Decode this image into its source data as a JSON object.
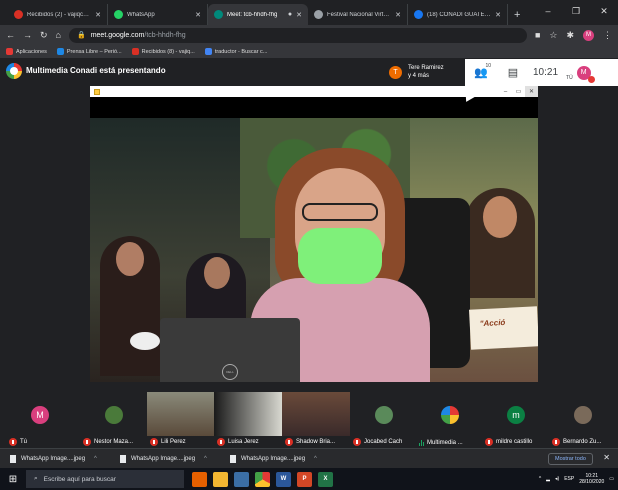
{
  "browser": {
    "tabs": [
      {
        "label": "Recibidos (2) - vajiqconad",
        "color": "#d93025"
      },
      {
        "label": "WhatsApp",
        "color": "#25d366"
      },
      {
        "label": "Meet: tcb-hhdh-fhg",
        "color": "#00897b"
      },
      {
        "label": "Festival Nacional Virtual In",
        "color": "#9aa0a6"
      },
      {
        "label": "(18) CONADI GUATEMALA",
        "color": "#1877f2"
      }
    ],
    "new_tab": "+",
    "url_host": "meet.google.com",
    "url_path": "/tcb-hhdh-fhg",
    "profile_letter": "M"
  },
  "bookmarks": [
    {
      "label": "Aplicaciones",
      "color": "#e53935"
    },
    {
      "label": "Prensa Libre – Perió...",
      "color": "#1e88e5"
    },
    {
      "label": "Recibidos (8) - vajiq...",
      "color": "#d93025"
    },
    {
      "label": "traductor - Buscar c...",
      "color": "#4285f4"
    }
  ],
  "meet": {
    "presenting_text": "Multimedia Conadi está presentando",
    "join_avatar": "T",
    "join_name": "Tere Ramirez",
    "join_sub": "y 4 más",
    "participants_count": "10",
    "time": "10:21",
    "you_label": "TÚ",
    "avatar_letter": "M",
    "banner_text": "\"Acció"
  },
  "participants": [
    {
      "name": "Tú",
      "avatar": "M",
      "color": "#d93f7e",
      "muted": true
    },
    {
      "name": "Nestor Maza...",
      "avatar": "",
      "color": "#4a7a3a",
      "muted": true
    },
    {
      "name": "Lili Perez",
      "avatar": "",
      "color": "#6b5d4a",
      "muted": true
    },
    {
      "name": "Luisa Jerez",
      "avatar": "",
      "color": "#3a3a3a",
      "muted": true
    },
    {
      "name": "Shadow Bria...",
      "avatar": "",
      "color": "#4a3a4a",
      "muted": true
    },
    {
      "name": "Jocabed Cach",
      "avatar": "",
      "color": "#5a8a5a",
      "muted": true
    },
    {
      "name": "Multimedia ...",
      "avatar": "",
      "color": "#5a6aa0",
      "muted": false
    },
    {
      "name": "mildre castillo",
      "avatar": "m",
      "color": "#0b8043",
      "muted": true
    },
    {
      "name": "Bernardo Zu...",
      "avatar": "",
      "color": "#7a6a5a",
      "muted": true
    }
  ],
  "downloads": {
    "items": [
      "WhatsApp Image....jpeg",
      "WhatsApp Image....jpeg",
      "WhatsApp Image....jpeg"
    ],
    "show_all": "Mostrar todo"
  },
  "taskbar": {
    "search_placeholder": "Escribe aquí para buscar",
    "lang": "ESP",
    "time": "10:21",
    "date": "28/10/2020"
  }
}
